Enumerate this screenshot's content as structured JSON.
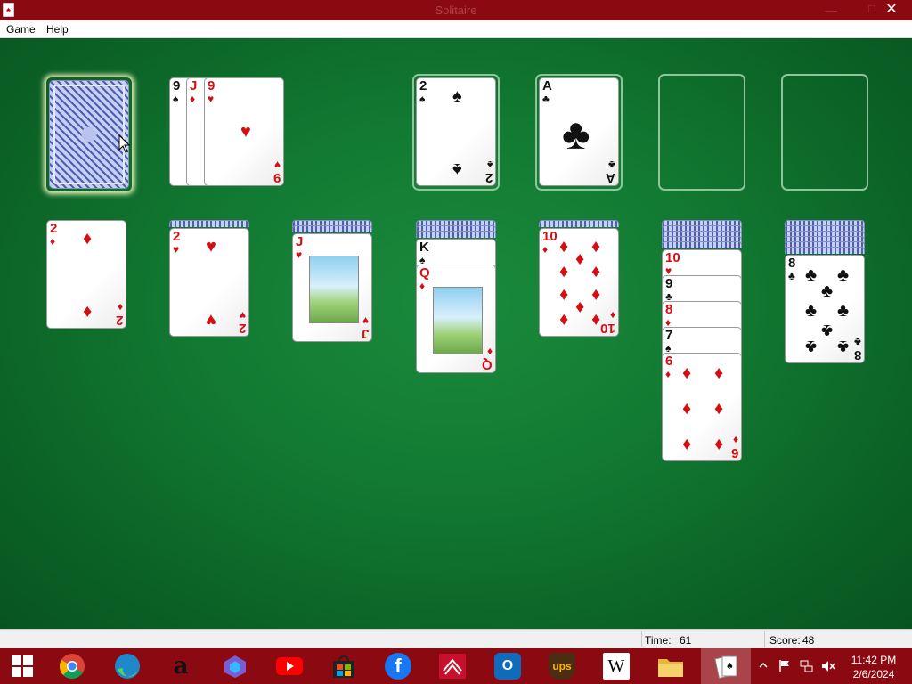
{
  "window": {
    "title": "Solitaire",
    "minimize": "—",
    "maximize": "☐",
    "close": "✕"
  },
  "menu": {
    "items": [
      "Game",
      "Help"
    ]
  },
  "status": {
    "time_label": "Time:",
    "time_value": "61",
    "score_label": "Score:",
    "score_value": "48"
  },
  "stock": {
    "face_down": true
  },
  "waste": [
    {
      "rank": "9",
      "suit": "♠",
      "color": "black"
    },
    {
      "rank": "J",
      "suit": "♦",
      "color": "red"
    },
    {
      "rank": "9",
      "suit": "♥",
      "color": "red"
    }
  ],
  "foundations": [
    {
      "rank": "2",
      "suit": "♠",
      "color": "black"
    },
    {
      "rank": "A",
      "suit": "♣",
      "color": "black"
    },
    {
      "empty": true
    },
    {
      "empty": true
    }
  ],
  "tableau": [
    {
      "hidden": 0,
      "cards": [
        {
          "rank": "2",
          "suit": "♦",
          "color": "red"
        }
      ]
    },
    {
      "hidden": 1,
      "cards": [
        {
          "rank": "2",
          "suit": "♥",
          "color": "red"
        }
      ]
    },
    {
      "hidden": 2,
      "cards": [
        {
          "rank": "J",
          "suit": "♥",
          "color": "red"
        }
      ]
    },
    {
      "hidden": 3,
      "cards": [
        {
          "rank": "K",
          "suit": "♠",
          "color": "black"
        },
        {
          "rank": "Q",
          "suit": "♦",
          "color": "red"
        }
      ]
    },
    {
      "hidden": 1,
      "cards": [
        {
          "rank": "10",
          "suit": "♦",
          "color": "red"
        }
      ]
    },
    {
      "hidden": 5,
      "cards": [
        {
          "rank": "10",
          "suit": "♥",
          "color": "red"
        },
        {
          "rank": "9",
          "suit": "♣",
          "color": "black"
        },
        {
          "rank": "8",
          "suit": "♦",
          "color": "red"
        },
        {
          "rank": "7",
          "suit": "♠",
          "color": "black"
        },
        {
          "rank": "6",
          "suit": "♦",
          "color": "red"
        }
      ]
    },
    {
      "hidden": 6,
      "cards": [
        {
          "rank": "8",
          "suit": "♣",
          "color": "black"
        }
      ]
    }
  ],
  "taskbar": {
    "apps": [
      "start",
      "chrome",
      "edge",
      "amazon",
      "copilot",
      "youtube",
      "store",
      "facebook",
      "bank",
      "outlook",
      "ups",
      "wikipedia",
      "file-explorer",
      "solitaire"
    ],
    "wiki_letter": "W",
    "ups_text": "ups",
    "amazon_letter": "a",
    "facebook_letter": "f",
    "outlook_letter": "O",
    "clock_time": "11:42 PM",
    "clock_date": "2/6/2024"
  },
  "colors": {
    "title_bar": "#8b0a12",
    "table": "#127a32",
    "red_suit": "#d40f14",
    "black_suit": "#111111"
  }
}
